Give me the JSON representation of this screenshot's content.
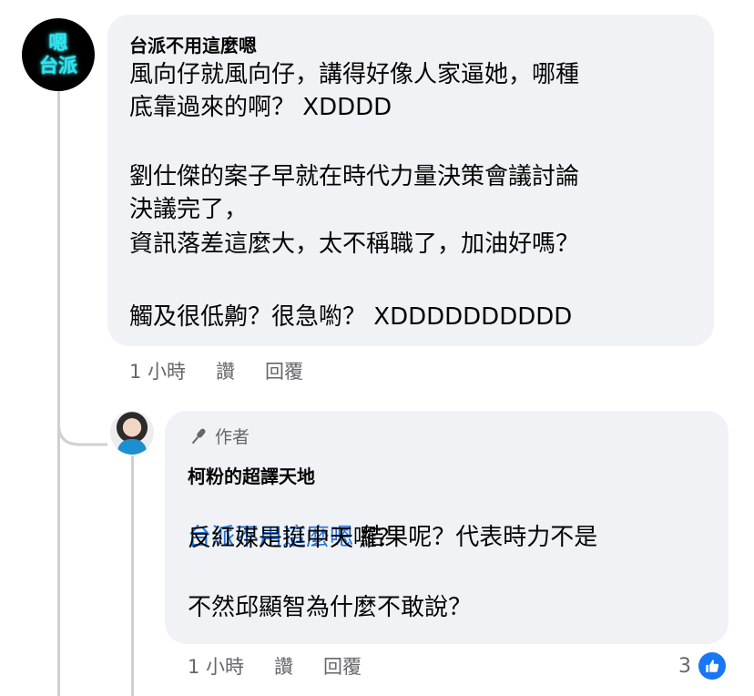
{
  "comment": {
    "avatar_text": [
      "嗯",
      "台派"
    ],
    "author": "台派不用這麼嗯",
    "lines": [
      "風向仔就風向仔，講得好像人家逼她，哪種",
      "底靠過來的啊？  XDDDD",
      "",
      "劉仕傑的案子早就在時代力量決策會議討論",
      "決議完了，",
      "資訊落差這麼大，太不稱職了，加油好嗎？",
      "",
      "觸及很低齁？很急喲？  XDDDDDDDDDD"
    ],
    "time": "1 小時",
    "like_label": "讚",
    "reply_label": "回覆"
  },
  "reply": {
    "badge": "作者",
    "author": "柯粉的超譯天地",
    "mention": "台派不用這麼嗯",
    "line1_rest": "  結果呢？代表時力不是",
    "lines": [
      "反紅媒是挺中天囉？",
      "",
      "不然邱顯智為什麼不敢說？"
    ],
    "time": "1 小時",
    "like_label": "讚",
    "reply_label": "回覆",
    "reaction_count": "3",
    "reaction_icon": "like-icon",
    "accent_color": "#1877f2",
    "mention_color": "#216fdb"
  }
}
